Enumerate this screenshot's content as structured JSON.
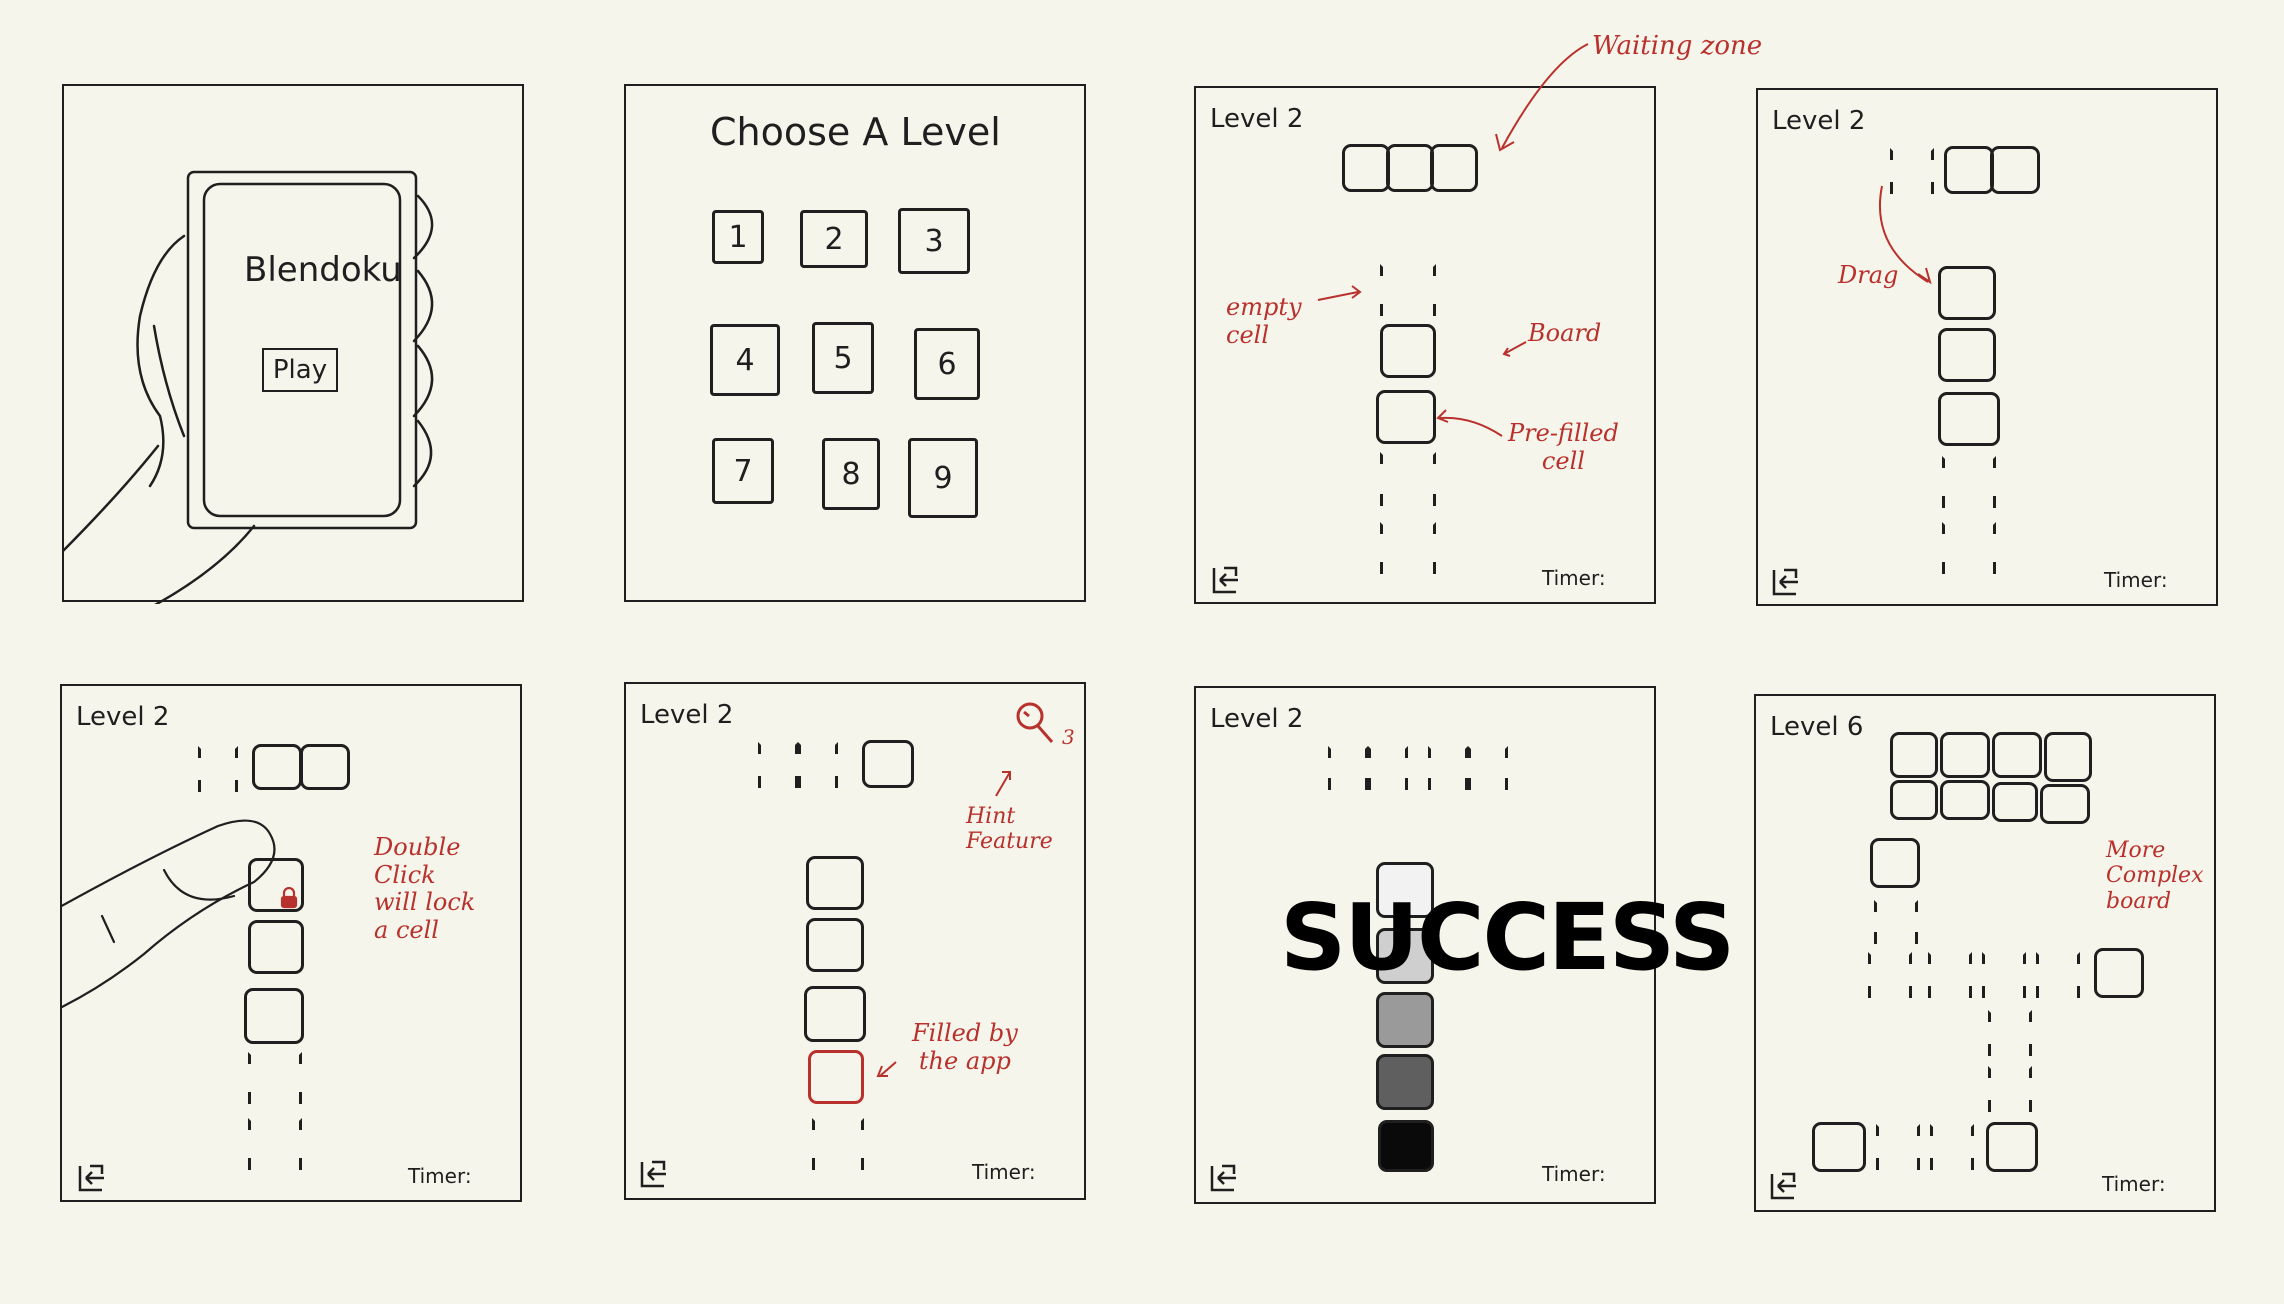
{
  "frames": {
    "home": {
      "app_name": "Blendoku",
      "play_label": "Play"
    },
    "choose": {
      "title": "Choose A Level",
      "levels": [
        "1",
        "2",
        "3",
        "4",
        "5",
        "6",
        "7",
        "8",
        "9"
      ]
    },
    "f3": {
      "level": "Level 2",
      "timer": "Timer:",
      "notes": {
        "waiting_zone": "Waiting zone",
        "empty_cell": "empty\ncell",
        "board": "Board",
        "prefilled": "Pre-filled\ncell"
      }
    },
    "f4": {
      "level": "Level 2",
      "timer": "Timer:",
      "notes": {
        "drag": "Drag"
      }
    },
    "f5": {
      "level": "Level 2",
      "timer": "Timer:",
      "notes": {
        "lock": "Double\nClick\nwill lock\na cell"
      }
    },
    "f6": {
      "level": "Level 2",
      "timer": "Timer:",
      "hint_count": "3",
      "notes": {
        "hint": "Hint\nFeature",
        "filled": "Filled by\nthe app"
      }
    },
    "f7": {
      "level": "Level 2",
      "timer": "Timer:",
      "success": "SUCCESS"
    },
    "f8": {
      "level": "Level 6",
      "timer": "Timer:",
      "notes": {
        "complex": "More\nComplex\nboard"
      }
    }
  },
  "colors": {
    "ink": "#1f1f1f",
    "annotation": "#b9312c",
    "paper": "#f6f5ec",
    "gradient": [
      "#f2f2f2",
      "#cfcfcf",
      "#9a9a9a",
      "#5f5f5f",
      "#0a0a0a"
    ]
  }
}
